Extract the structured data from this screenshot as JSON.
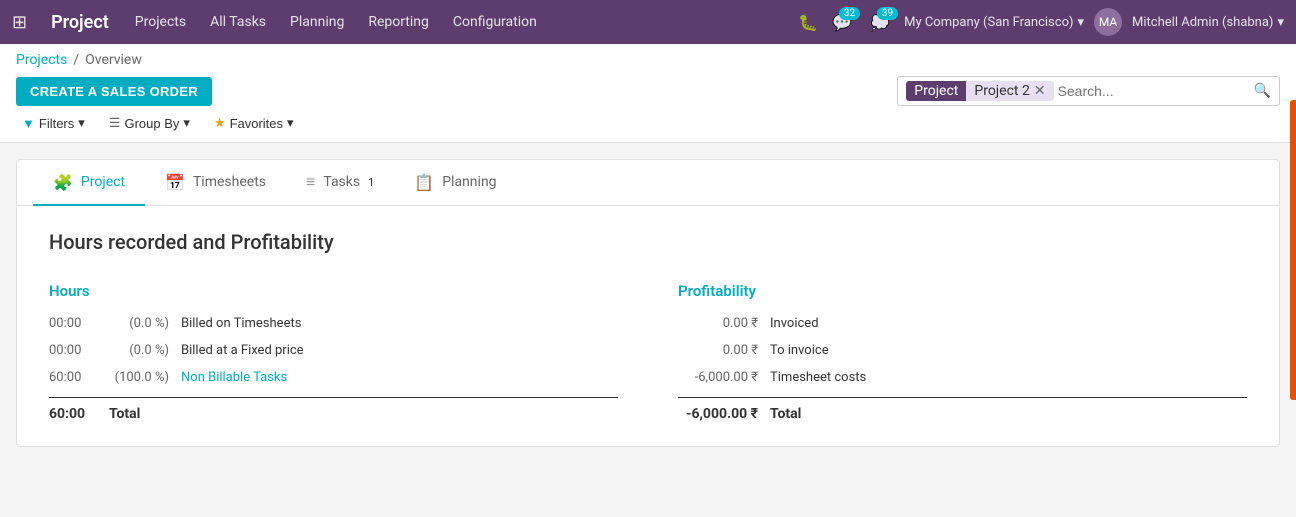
{
  "app": {
    "name": "Project"
  },
  "navbar": {
    "nav_items": [
      "Projects",
      "All Tasks",
      "Planning",
      "Reporting",
      "Configuration"
    ],
    "badge_32": "32",
    "badge_39": "39",
    "company": "My Company (San Francisco)",
    "user": "Mitchell Admin (shabna)"
  },
  "breadcrumb": {
    "parent": "Projects",
    "separator": "/",
    "current": "Overview"
  },
  "create_button": "CREATE A SALES ORDER",
  "search": {
    "tag_label": "Project",
    "tag_value": "Project 2",
    "placeholder": "Search..."
  },
  "filters": {
    "filters_label": "Filters",
    "group_by_label": "Group By",
    "favorites_label": "Favorites"
  },
  "tabs": [
    {
      "icon": "puzzle",
      "label": "Project",
      "count": ""
    },
    {
      "icon": "calendar",
      "label": "Timesheets",
      "count": ""
    },
    {
      "icon": "tasks",
      "label": "Tasks",
      "count": "1"
    },
    {
      "icon": "list",
      "label": "Planning",
      "count": ""
    }
  ],
  "section_title": "Hours recorded and Profitability",
  "hours": {
    "col_title": "Hours",
    "rows": [
      {
        "time": "00:00",
        "pct": "(0.0 %)",
        "label": "Billed on Timesheets",
        "is_link": false
      },
      {
        "time": "00:00",
        "pct": "(0.0 %)",
        "label": "Billed at a Fixed price",
        "is_link": false
      },
      {
        "time": "60:00",
        "pct": "(100.0 %)",
        "label": "Non Billable Tasks",
        "is_link": true
      }
    ],
    "total": {
      "time": "60:00",
      "label": "Total"
    }
  },
  "profitability": {
    "col_title": "Profitability",
    "rows": [
      {
        "amount": "0.00 ₹",
        "label": "Invoiced"
      },
      {
        "amount": "0.00 ₹",
        "label": "To invoice"
      },
      {
        "amount": "-6,000.00 ₹",
        "label": "Timesheet costs"
      }
    ],
    "total": {
      "amount": "-6,000.00 ₹",
      "label": "Total"
    }
  }
}
